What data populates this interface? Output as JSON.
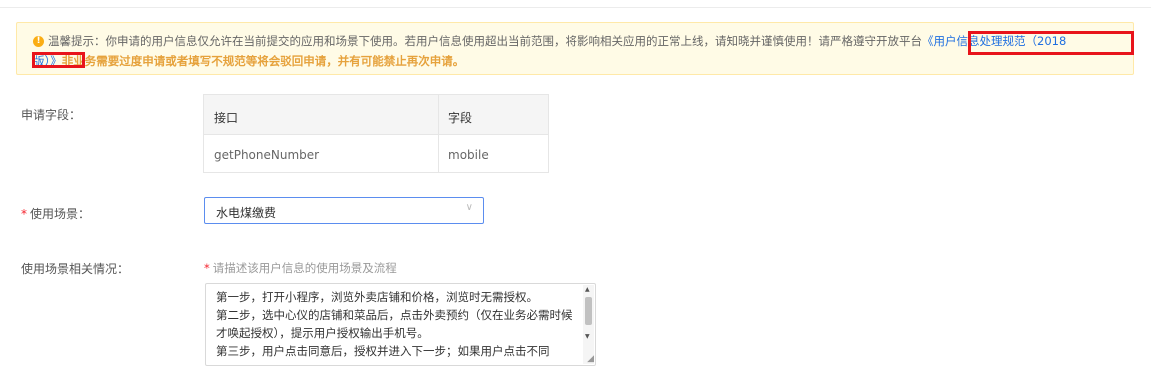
{
  "notice": {
    "icon": "warning-icon",
    "text_gray": "温馨提示：你申请的用户信息仅允许在当前提交的应用和场景下使用。若用户信息使用超出当前范围，将影响相关应用的正常上线，请知晓并谨慎使用！请严格遵守开放平台",
    "link_part1": "《用户信息处理规范（2018",
    "link_part2": "版）》",
    "text_orange": "非业务需要过度申请或者填写不规范等将会驳回申请，并有可能禁止再次申请。"
  },
  "fields": {
    "label": "申请字段：",
    "headers": [
      "接口",
      "字段"
    ],
    "rows": [
      [
        "getPhoneNumber",
        "mobile"
      ]
    ]
  },
  "scene": {
    "required_mark": "*",
    "label": "使用场景：",
    "value": "水电煤缴费",
    "icon": "chevron-down-icon"
  },
  "details": {
    "label": "使用场景相关情况：",
    "required_mark": "*",
    "hint": "请描述该用户信息的使用场景及流程",
    "text": "第一步，打开小程序，浏览外卖店铺和价格，浏览时无需授权。\n第二步，选中心仪的店铺和菜品后，点击外卖预约（仅在业务必需时候才唤起授权），提示用户授权输出手机号。\n第三步，用户点击同意后，授权并进入下一步；如果用户点击不同"
  },
  "colors": {
    "accent": "#1f6fe0",
    "warning": "#faad14",
    "highlight": "#e8141b",
    "notice_text": "#e6a23c"
  }
}
